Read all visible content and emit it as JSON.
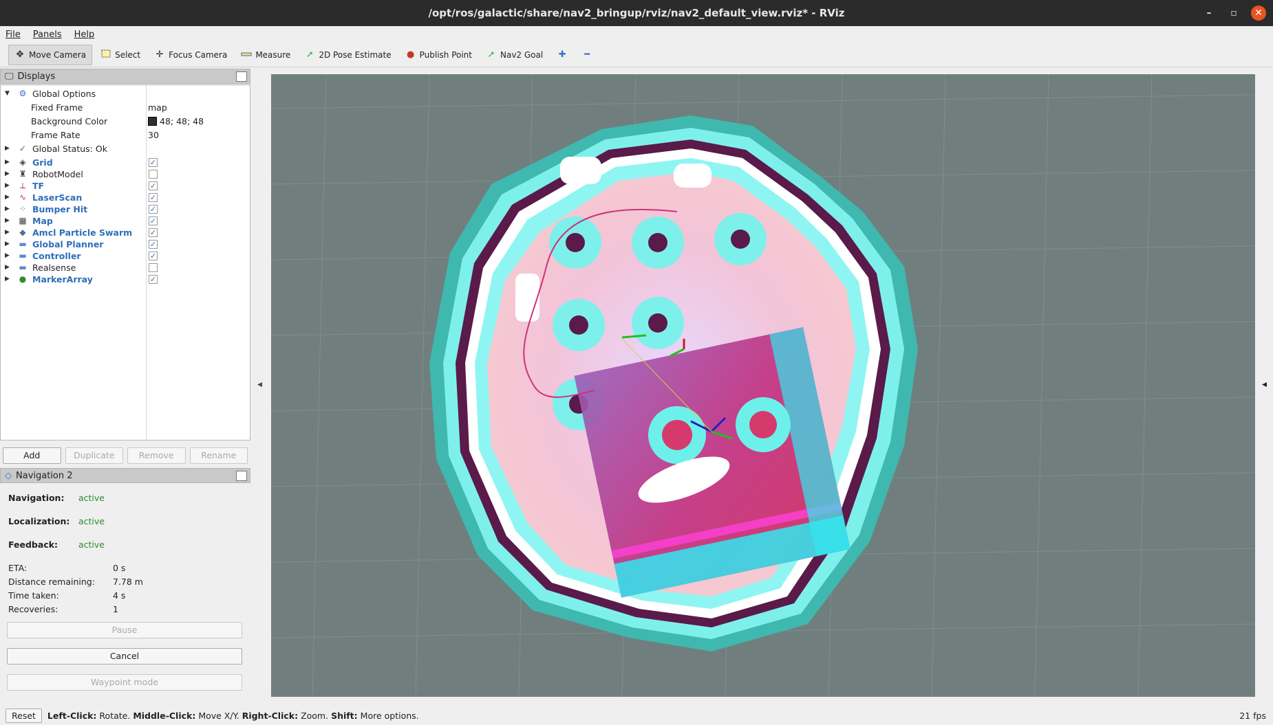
{
  "window": {
    "title": "/opt/ros/galactic/share/nav2_bringup/rviz/nav2_default_view.rviz* - RViz",
    "minimize": "–",
    "restore": "▫",
    "close": "✕"
  },
  "menu": [
    "File",
    "Panels",
    "Help"
  ],
  "toolbar": {
    "tools": [
      {
        "label": "Move Camera",
        "icon": "move-icon",
        "active": true
      },
      {
        "label": "Select",
        "icon": "select-icon"
      },
      {
        "label": "Focus Camera",
        "icon": "focus-icon"
      },
      {
        "label": "Measure",
        "icon": "ruler-icon"
      },
      {
        "label": "2D Pose Estimate",
        "icon": "pose-arrow-icon"
      },
      {
        "label": "Publish Point",
        "icon": "pin-icon"
      },
      {
        "label": "Nav2 Goal",
        "icon": "goal-arrow-icon"
      }
    ]
  },
  "displays": {
    "title": "Displays",
    "global_options": "Global Options",
    "fixed_frame_label": "Fixed Frame",
    "fixed_frame_value": "map",
    "bg_color_label": "Background Color",
    "bg_color_value": "48; 48; 48",
    "frame_rate_label": "Frame Rate",
    "frame_rate_value": "30",
    "global_status": "Global Status: Ok",
    "items": [
      {
        "label": "Grid",
        "checked": true,
        "bold": true,
        "icon": "grid-icon"
      },
      {
        "label": "RobotModel",
        "checked": false,
        "bold": false,
        "icon": "robot-icon"
      },
      {
        "label": "TF",
        "checked": true,
        "bold": true,
        "icon": "tf-icon"
      },
      {
        "label": "LaserScan",
        "checked": true,
        "bold": true,
        "icon": "laser-icon"
      },
      {
        "label": "Bumper Hit",
        "checked": true,
        "bold": true,
        "icon": "bumper-icon"
      },
      {
        "label": "Map",
        "checked": true,
        "bold": true,
        "icon": "map-icon"
      },
      {
        "label": "Amcl Particle Swarm",
        "checked": true,
        "bold": true,
        "icon": "particle-icon"
      },
      {
        "label": "Global Planner",
        "checked": true,
        "bold": true,
        "icon": "folder-icon"
      },
      {
        "label": "Controller",
        "checked": true,
        "bold": true,
        "icon": "folder-icon"
      },
      {
        "label": "Realsense",
        "checked": false,
        "bold": false,
        "icon": "folder-icon"
      },
      {
        "label": "MarkerArray",
        "checked": true,
        "bold": true,
        "icon": "marker-icon"
      }
    ],
    "buttons": {
      "add": "Add",
      "duplicate": "Duplicate",
      "remove": "Remove",
      "rename": "Rename"
    }
  },
  "nav2": {
    "title": "Navigation 2",
    "navigation_label": "Navigation:",
    "navigation_value": "active",
    "localization_label": "Localization:",
    "localization_value": "active",
    "feedback_label": "Feedback:",
    "feedback_value": "active",
    "eta_label": "ETA:",
    "eta_value": "0 s",
    "distance_label": "Distance remaining:",
    "distance_value": "7.78 m",
    "time_label": "Time taken:",
    "time_value": "4 s",
    "recoveries_label": "Recoveries:",
    "recoveries_value": "1",
    "pause": "Pause",
    "cancel": "Cancel",
    "waypoint": "Waypoint mode"
  },
  "status": {
    "reset": "Reset",
    "left_click": "Left-Click:",
    "left_click_text": "Rotate.",
    "middle_click": "Middle-Click:",
    "middle_click_text": "Move X/Y.",
    "right_click": "Right-Click:",
    "right_click_text": "Zoom.",
    "shift": "Shift:",
    "shift_text": "More options.",
    "fps": "21 fps"
  },
  "colors": {
    "viewport_bg": "#707f7d",
    "accent": "#2e6eb8",
    "active_green": "#2e8b2e",
    "close_btn": "#e95420"
  }
}
